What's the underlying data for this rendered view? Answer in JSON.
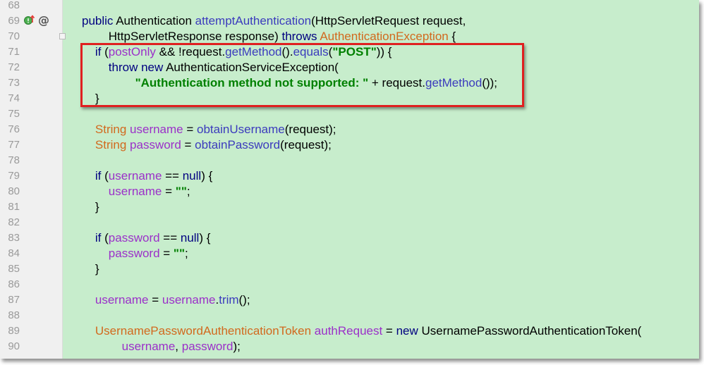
{
  "colors": {
    "editor_background": "#c7edcc",
    "gutter_background": "#f0f0f0",
    "keyword": "#000080",
    "method": "#3b3bbd",
    "type": "#d2691e",
    "variable": "#9b30c9",
    "string": "#008000",
    "highlight_border": "#e02020"
  },
  "gutter_icons": {
    "line_69": [
      "override-method-icon",
      "annotation-at-icon"
    ],
    "at_symbol": "@"
  },
  "lines": [
    {
      "number": "68",
      "tokens": []
    },
    {
      "number": "69",
      "tokens": [
        {
          "t": "public ",
          "c": "kw"
        },
        {
          "t": "Authentication ",
          "c": "pl"
        },
        {
          "t": "attemptAuthentication",
          "c": "fn"
        },
        {
          "t": "(HttpServletRequest request,",
          "c": "pl"
        }
      ]
    },
    {
      "number": "70",
      "tokens": [
        {
          "t": "        HttpServletResponse response) ",
          "c": "pl"
        },
        {
          "t": "throws ",
          "c": "kw"
        },
        {
          "t": "AuthenticationException",
          "c": "ty"
        },
        {
          "t": " {",
          "c": "pl"
        }
      ]
    },
    {
      "number": "71",
      "tokens": [
        {
          "t": "    if ",
          "c": "kw"
        },
        {
          "t": "(",
          "c": "pl"
        },
        {
          "t": "postOnly",
          "c": "var"
        },
        {
          "t": " && !request.",
          "c": "pl"
        },
        {
          "t": "getMethod",
          "c": "fn"
        },
        {
          "t": "().",
          "c": "pl"
        },
        {
          "t": "equals",
          "c": "fn"
        },
        {
          "t": "(",
          "c": "pl"
        },
        {
          "t": "\"POST\"",
          "c": "str"
        },
        {
          "t": ")) {",
          "c": "pl"
        }
      ]
    },
    {
      "number": "72",
      "tokens": [
        {
          "t": "        throw new ",
          "c": "kw"
        },
        {
          "t": "AuthenticationServiceException(",
          "c": "pl"
        }
      ]
    },
    {
      "number": "73",
      "tokens": [
        {
          "t": "                \"Authentication method not supported: \"",
          "c": "str"
        },
        {
          "t": " + request.",
          "c": "pl"
        },
        {
          "t": "getMethod",
          "c": "fn"
        },
        {
          "t": "());",
          "c": "pl"
        }
      ]
    },
    {
      "number": "74",
      "tokens": [
        {
          "t": "    }",
          "c": "pl"
        }
      ]
    },
    {
      "number": "75",
      "tokens": []
    },
    {
      "number": "76",
      "tokens": [
        {
          "t": "    String ",
          "c": "ty"
        },
        {
          "t": "username",
          "c": "var"
        },
        {
          "t": " = ",
          "c": "pl"
        },
        {
          "t": "obtainUsername",
          "c": "fn"
        },
        {
          "t": "(request);",
          "c": "pl"
        }
      ]
    },
    {
      "number": "77",
      "tokens": [
        {
          "t": "    String ",
          "c": "ty"
        },
        {
          "t": "password",
          "c": "var"
        },
        {
          "t": " = ",
          "c": "pl"
        },
        {
          "t": "obtainPassword",
          "c": "fn"
        },
        {
          "t": "(request);",
          "c": "pl"
        }
      ]
    },
    {
      "number": "78",
      "tokens": []
    },
    {
      "number": "79",
      "tokens": [
        {
          "t": "    if ",
          "c": "kw"
        },
        {
          "t": "(",
          "c": "pl"
        },
        {
          "t": "username",
          "c": "var"
        },
        {
          "t": " == ",
          "c": "pl"
        },
        {
          "t": "null",
          "c": "kw"
        },
        {
          "t": ") {",
          "c": "pl"
        }
      ]
    },
    {
      "number": "80",
      "tokens": [
        {
          "t": "        username",
          "c": "var"
        },
        {
          "t": " = ",
          "c": "pl"
        },
        {
          "t": "\"\"",
          "c": "str"
        },
        {
          "t": ";",
          "c": "pl"
        }
      ]
    },
    {
      "number": "81",
      "tokens": [
        {
          "t": "    }",
          "c": "pl"
        }
      ]
    },
    {
      "number": "82",
      "tokens": []
    },
    {
      "number": "83",
      "tokens": [
        {
          "t": "    if ",
          "c": "kw"
        },
        {
          "t": "(",
          "c": "pl"
        },
        {
          "t": "password",
          "c": "var"
        },
        {
          "t": " == ",
          "c": "pl"
        },
        {
          "t": "null",
          "c": "kw"
        },
        {
          "t": ") {",
          "c": "pl"
        }
      ]
    },
    {
      "number": "84",
      "tokens": [
        {
          "t": "        password",
          "c": "var"
        },
        {
          "t": " = ",
          "c": "pl"
        },
        {
          "t": "\"\"",
          "c": "str"
        },
        {
          "t": ";",
          "c": "pl"
        }
      ]
    },
    {
      "number": "85",
      "tokens": [
        {
          "t": "    }",
          "c": "pl"
        }
      ]
    },
    {
      "number": "86",
      "tokens": []
    },
    {
      "number": "87",
      "tokens": [
        {
          "t": "    username",
          "c": "var"
        },
        {
          "t": " = ",
          "c": "pl"
        },
        {
          "t": "username",
          "c": "var"
        },
        {
          "t": ".",
          "c": "pl"
        },
        {
          "t": "trim",
          "c": "fn"
        },
        {
          "t": "();",
          "c": "pl"
        }
      ]
    },
    {
      "number": "88",
      "tokens": []
    },
    {
      "number": "89",
      "tokens": [
        {
          "t": "    UsernamePasswordAuthenticationToken ",
          "c": "ty"
        },
        {
          "t": "authRequest",
          "c": "var"
        },
        {
          "t": " = ",
          "c": "pl"
        },
        {
          "t": "new ",
          "c": "kw"
        },
        {
          "t": "UsernamePasswordAuthenticationToken(",
          "c": "pl"
        }
      ]
    },
    {
      "number": "90",
      "tokens": [
        {
          "t": "            username",
          "c": "var"
        },
        {
          "t": ", ",
          "c": "pl"
        },
        {
          "t": "password",
          "c": "var"
        },
        {
          "t": ");",
          "c": "pl"
        }
      ]
    }
  ]
}
